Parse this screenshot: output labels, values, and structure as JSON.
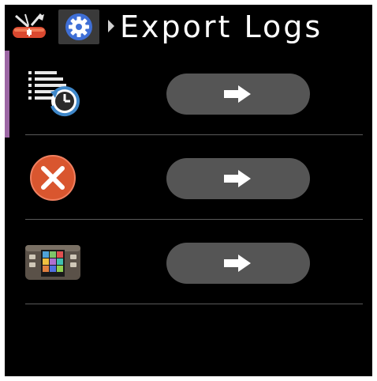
{
  "header": {
    "title": "Export Logs",
    "app_icon": "multitool-icon",
    "settings_icon": "gear-icon",
    "breadcrumb_icon": "chevron-right-icon"
  },
  "rows": [
    {
      "name": "history-logs",
      "icon": "log-history-icon",
      "action_icon": "arrow-right-icon"
    },
    {
      "name": "cancel",
      "icon": "cancel-icon",
      "action_icon": "arrow-right-icon"
    },
    {
      "name": "device",
      "icon": "device-screen-icon",
      "action_icon": "arrow-right-icon"
    }
  ],
  "colors": {
    "background": "#000000",
    "button": "#555555",
    "accent": "#9c67a4",
    "cancel": "#d9562f",
    "settings_badge": "#3f6fd6"
  }
}
